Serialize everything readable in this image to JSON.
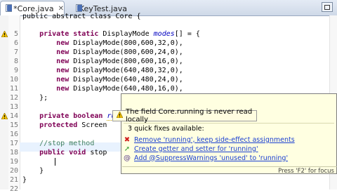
{
  "tabs": [
    {
      "label": "*Core.java",
      "active": true
    },
    {
      "label": "KeyTest.java",
      "active": false
    }
  ],
  "code_lines": [
    {
      "num": "",
      "text": "public abstract class Core {"
    },
    {
      "num": "5",
      "text": ""
    },
    {
      "num": "6",
      "text": "    private static DisplayMode modes[] = {"
    },
    {
      "num": "7",
      "text": "        new DisplayMode(800,600,32,0),"
    },
    {
      "num": "8",
      "text": "        new DisplayMode(800,600,24,0),"
    },
    {
      "num": "9",
      "text": "        new DisplayMode(800,600,16,0),"
    },
    {
      "num": "10",
      "text": "        new DisplayMode(640,480,32,0),"
    },
    {
      "num": "11",
      "text": "        new DisplayMode(640,480,24,0),"
    },
    {
      "num": "12",
      "text": "        new DisplayMode(640,480,16,0),"
    },
    {
      "num": "13",
      "text": "    };"
    },
    {
      "num": "14",
      "text": "    private boolean running;"
    },
    {
      "num": "15",
      "text": "    protected Screen"
    },
    {
      "num": "16",
      "text": ""
    },
    {
      "num": "17",
      "text": "    //stop method"
    },
    {
      "num": "18",
      "text": "    public void stop"
    },
    {
      "num": "19",
      "text": ""
    },
    {
      "num": "20",
      "text": "    }"
    },
    {
      "num": "21",
      "text": "}"
    },
    {
      "num": "22",
      "text": ""
    }
  ],
  "hover_tip": {
    "text": "The field Core.running is never read locally"
  },
  "quick_fix": {
    "header": "3 quick fixes available:",
    "items": [
      {
        "label": "Remove 'running', keep side-effect assignments",
        "icon": "remove-icon"
      },
      {
        "label": "Create getter and setter for 'running'",
        "icon": "green-arrow-icon"
      },
      {
        "label": "Add @SuppressWarnings 'unused' to 'running'",
        "icon": "at-icon"
      }
    ],
    "footer": "Press 'F2' for focus"
  },
  "colors": {
    "keyword": "#7f0055",
    "field": "#0000c0",
    "comment": "#3f7f5f",
    "link": "#1a3fd1"
  }
}
